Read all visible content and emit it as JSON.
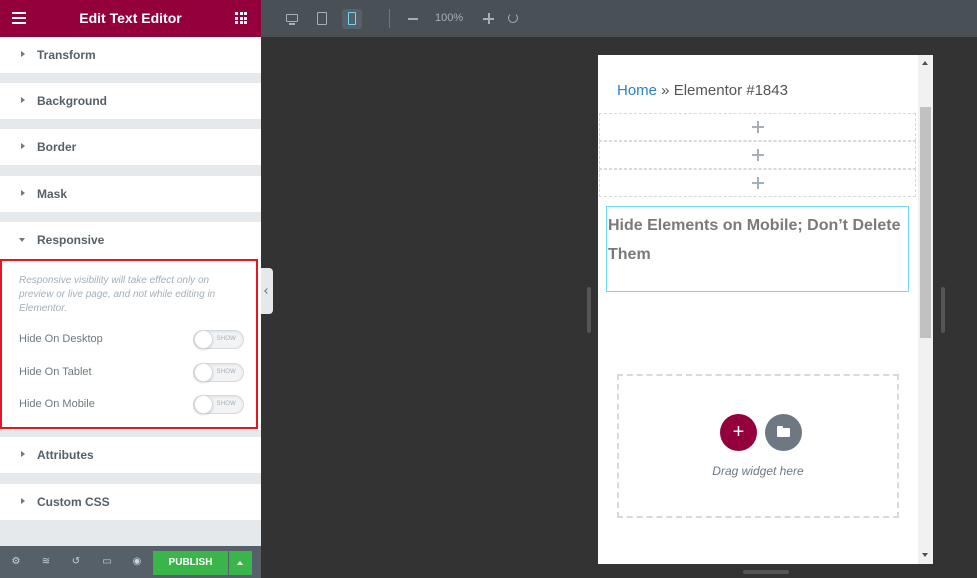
{
  "panel": {
    "title": "Edit Text Editor",
    "sections_top": [
      "Transform",
      "Background",
      "Border",
      "Mask"
    ],
    "responsive": {
      "label": "Responsive",
      "note": "Responsive visibility will take effect only on preview or live page, and not while editing in Elementor.",
      "toggles": [
        {
          "label": "Hide On Desktop",
          "state": "SHOW"
        },
        {
          "label": "Hide On Tablet",
          "state": "SHOW"
        },
        {
          "label": "Hide On Mobile",
          "state": "SHOW"
        }
      ]
    },
    "sections_bottom": [
      "Attributes",
      "Custom CSS"
    ],
    "footer": {
      "publish_label": "PUBLISH"
    }
  },
  "toolbar": {
    "devices": [
      "desktop-icon",
      "tablet-icon",
      "mobile-icon"
    ],
    "active_device": "mobile",
    "zoom": "100%"
  },
  "preview": {
    "breadcrumb_home": "Home",
    "breadcrumb_sep": " » ",
    "breadcrumb_current": "Elementor #1843",
    "heading": "Hide Elements on Mobile; Don’t Delete Them",
    "drop_hint": "Drag widget here",
    "add_symbol": "+"
  },
  "colors": {
    "brand": "#93003c",
    "publish": "#39b54a",
    "highlight_border": "#e8141f",
    "link": "#2a83c1",
    "widget_outline": "#71d7f7"
  }
}
